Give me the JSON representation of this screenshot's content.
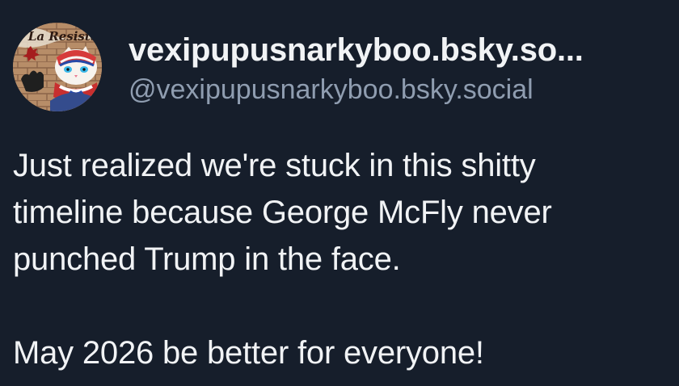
{
  "post": {
    "author": {
      "avatar_text": "e La Resista",
      "display_name": "vexipupusnarkyboo.bsky.so...",
      "handle": "@vexipupusnarkyboo.bsky.social"
    },
    "text": {
      "line1": "Just realized we're stuck in this shitty",
      "line2": "timeline because George McFly never",
      "line3": "punched Trump in the face.",
      "line4": "May 2026 be better for everyone!"
    }
  },
  "colors": {
    "background": "#161e2b",
    "primary_text": "#f1f3f5",
    "secondary_text": "#8f9db0"
  }
}
